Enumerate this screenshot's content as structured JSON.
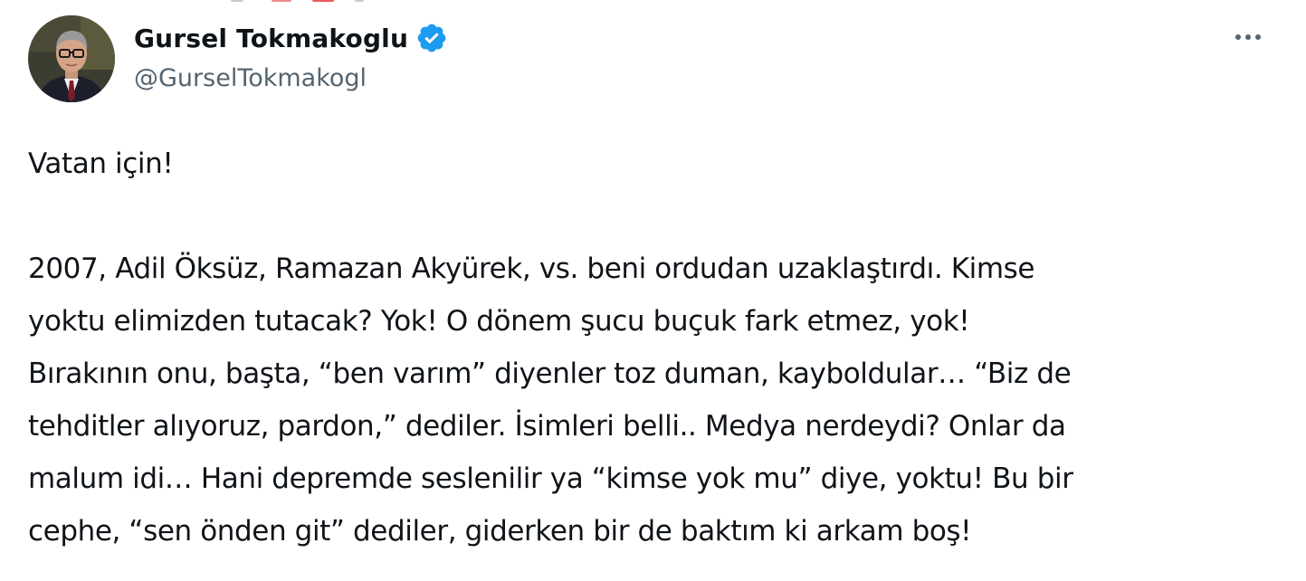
{
  "author": {
    "display_name": "Gursel Tokmakoglu",
    "handle": "@GurselTokmakogl",
    "verified": true,
    "avatar_icon": "profile-photo-man-with-glasses"
  },
  "tweet": {
    "lines": [
      "Vatan için!",
      "",
      "2007, Adil Öksüz, Ramazan Akyürek, vs. beni ordudan uzaklaştırdı. Kimse",
      "yoktu elimizden tutacak? Yok! O dönem şucu buçuk fark etmez, yok!",
      "Bırakının onu, başta, “ben varım” diyenler toz duman, kayboldular… “Biz de",
      "tehditler alıyoruz, pardon,” dediler. İsimleri belli.. Medya nerdeydi? Onlar da",
      "malum idi… Hani depremde seslenilir ya “kimse yok mu” diye, yoktu! Bu bir",
      "cephe, “sen önden git” dediler, giderken bir de baktım ki arkam boş!"
    ]
  },
  "actions": {
    "more_icon": "more-horizontal-icon"
  },
  "colors": {
    "text": "#0f1419",
    "secondary_text": "#536471",
    "verified_badge": "#1d9bf0",
    "background": "#ffffff"
  }
}
